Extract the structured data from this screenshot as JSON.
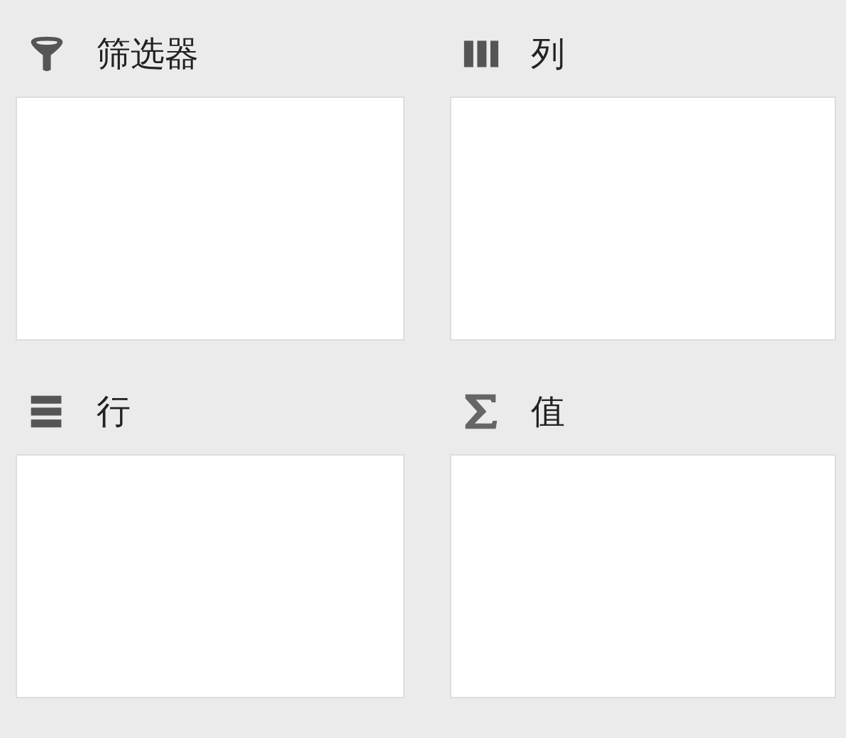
{
  "areas": [
    {
      "kind": "filter",
      "label": "筛选器"
    },
    {
      "kind": "columns",
      "label": "列"
    },
    {
      "kind": "rows",
      "label": "行"
    },
    {
      "kind": "values",
      "label": "值"
    }
  ]
}
